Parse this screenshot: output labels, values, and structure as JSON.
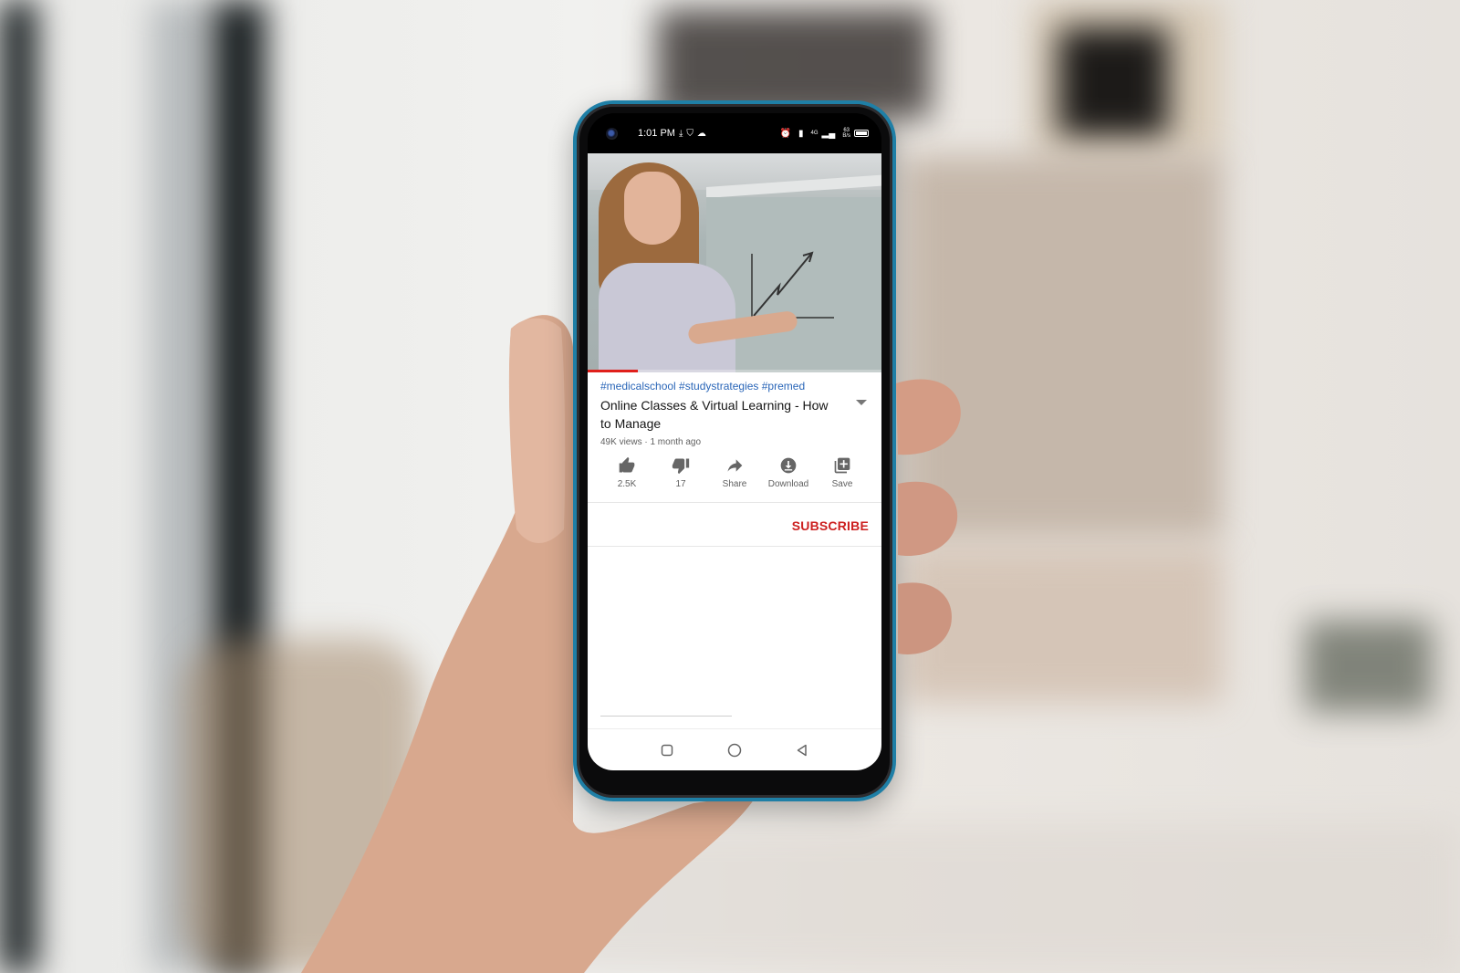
{
  "status_bar": {
    "time": "1:01 PM",
    "left_icons": [
      "download-icon",
      "shield-icon",
      "cloud-icon"
    ],
    "right_icons": [
      "alarm-icon",
      "vibrate-icon",
      "signal-icon",
      "battery-icon"
    ],
    "network": "4G",
    "speed_value": "63",
    "speed_unit": "B/s"
  },
  "video": {
    "progress_fraction": 0.17,
    "accent_color": "#e0201b"
  },
  "details": {
    "hashtags": "#medicalschool #studystrategies #premed",
    "title": "Online Classes & Virtual Learning - How to Manage",
    "meta": "49K views · 1 month ago"
  },
  "actions": [
    {
      "icon": "thumbs-up-icon",
      "label": "2.5K"
    },
    {
      "icon": "thumbs-down-icon",
      "label": "17"
    },
    {
      "icon": "share-icon",
      "label": "Share"
    },
    {
      "icon": "download-icon",
      "label": "Download"
    },
    {
      "icon": "save-playlist-icon",
      "label": "Save"
    }
  ],
  "subscribe_label": "SUBSCRIBE",
  "subscribe_color": "#cc1f1f",
  "nav_bar": {
    "buttons": [
      "recents-icon",
      "home-icon",
      "back-icon"
    ]
  }
}
